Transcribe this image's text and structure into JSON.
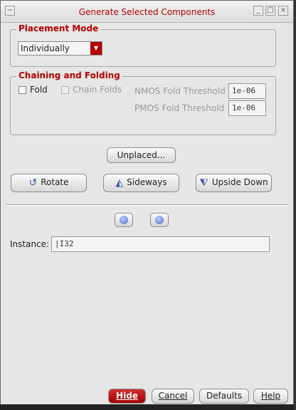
{
  "window": {
    "title": "Generate Selected Components",
    "menu_icon": "window-menu-icon",
    "minimize_icon": "minimize-icon",
    "maximize_icon": "maximize-icon",
    "close_icon": "close-icon"
  },
  "placement_mode": {
    "label": "Placement Mode",
    "selected": "Individually"
  },
  "chaining": {
    "label": "Chaining and Folding",
    "fold_label": "Fold",
    "chain_folds_label": "Chain Folds",
    "nmos_label": "NMOS Fold Threshold",
    "nmos_value": "1e-06",
    "pmos_label": "PMOS Fold Threshold",
    "pmos_value": "1e-06"
  },
  "buttons": {
    "unplaced": "Unplaced...",
    "rotate": "Rotate",
    "sideways": "Sideways",
    "upside_down": "Upside Down"
  },
  "instance": {
    "label": "Instance:",
    "value": "|I32"
  },
  "footer": {
    "hide": "Hide",
    "cancel": "Cancel",
    "defaults": "Defaults",
    "help": "Help"
  }
}
